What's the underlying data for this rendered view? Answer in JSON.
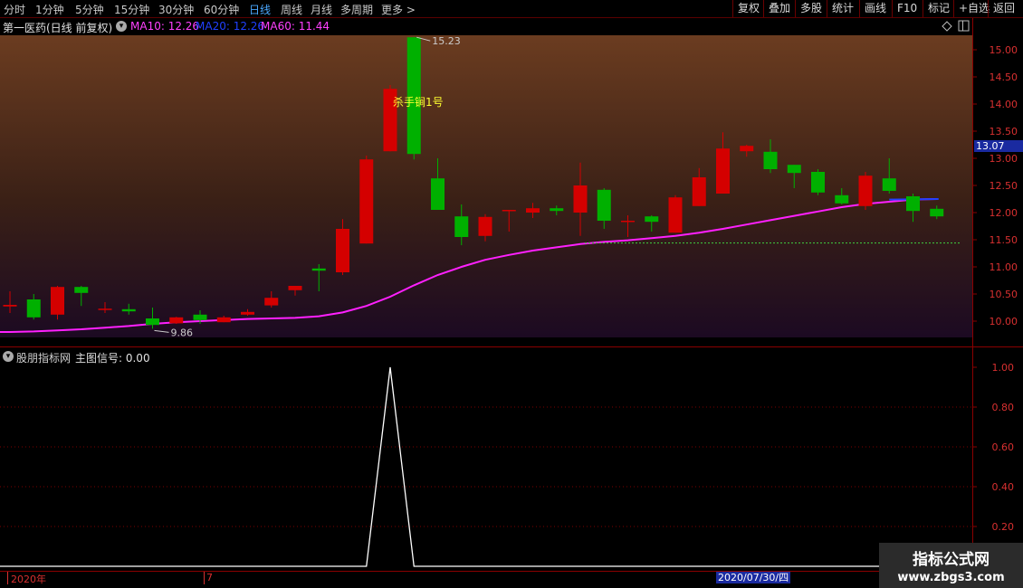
{
  "toolbar": {
    "periods": [
      {
        "label": "分时",
        "active": false
      },
      {
        "label": "1分钟",
        "active": false
      },
      {
        "label": "5分钟",
        "active": false
      },
      {
        "label": "15分钟",
        "active": false
      },
      {
        "label": "30分钟",
        "active": false
      },
      {
        "label": "60分钟",
        "active": false
      },
      {
        "label": "日线",
        "active": true
      },
      {
        "label": "周线",
        "active": false
      },
      {
        "label": "月线",
        "active": false
      },
      {
        "label": "多周期",
        "active": false
      },
      {
        "label": "更多 >",
        "active": false
      }
    ],
    "right_buttons": [
      "复权",
      "叠加",
      "多股",
      "统计",
      "画线",
      "F10",
      "标记",
      "+自选",
      "返回"
    ]
  },
  "title": {
    "stock": "第一医药(日线 前复权)",
    "ma10": "MA10: 12.26",
    "ma20": "MA20: 12.26",
    "ma60": "MA60: 11.44"
  },
  "chart_data": {
    "type": "candlestick",
    "ylim": [
      9.75,
      15.3
    ],
    "yticks": [
      "15.00",
      "14.50",
      "14.00",
      "13.50",
      "13.00",
      "12.50",
      "12.00",
      "11.50",
      "11.00",
      "10.50",
      "10.00"
    ],
    "current_price": "13.07",
    "candles": [
      {
        "o": 10.27,
        "h": 10.55,
        "l": 10.15,
        "c": 10.3
      },
      {
        "o": 10.4,
        "h": 10.5,
        "l": 10.03,
        "c": 10.07
      },
      {
        "o": 10.12,
        "h": 10.65,
        "l": 10.03,
        "c": 10.63
      },
      {
        "o": 10.63,
        "h": 10.65,
        "l": 10.28,
        "c": 10.52
      },
      {
        "o": 10.22,
        "h": 10.35,
        "l": 10.15,
        "c": 10.23
      },
      {
        "o": 10.22,
        "h": 10.32,
        "l": 10.12,
        "c": 10.18
      },
      {
        "o": 10.05,
        "h": 10.25,
        "l": 9.86,
        "c": 9.93
      },
      {
        "o": 9.96,
        "h": 10.08,
        "l": 9.95,
        "c": 10.07
      },
      {
        "o": 10.12,
        "h": 10.2,
        "l": 9.95,
        "c": 10.02
      },
      {
        "o": 9.98,
        "h": 10.1,
        "l": 9.98,
        "c": 10.07
      },
      {
        "o": 10.12,
        "h": 10.22,
        "l": 10.1,
        "c": 10.17
      },
      {
        "o": 10.29,
        "h": 10.55,
        "l": 10.25,
        "c": 10.43
      },
      {
        "o": 10.57,
        "h": 10.65,
        "l": 10.47,
        "c": 10.65
      },
      {
        "o": 10.97,
        "h": 11.05,
        "l": 10.55,
        "c": 10.93
      },
      {
        "o": 10.9,
        "h": 11.88,
        "l": 10.85,
        "c": 11.7
      },
      {
        "o": 11.43,
        "h": 13.05,
        "l": 11.43,
        "c": 12.98
      },
      {
        "o": 13.13,
        "h": 14.35,
        "l": 13.13,
        "c": 14.28
      },
      {
        "o": 15.23,
        "h": 15.23,
        "l": 12.98,
        "c": 13.08
      },
      {
        "o": 12.63,
        "h": 13.0,
        "l": 12.05,
        "c": 12.05
      },
      {
        "o": 11.93,
        "h": 12.15,
        "l": 11.4,
        "c": 11.55
      },
      {
        "o": 11.57,
        "h": 11.97,
        "l": 11.47,
        "c": 11.92
      },
      {
        "o": 12.03,
        "h": 12.05,
        "l": 11.65,
        "c": 12.05
      },
      {
        "o": 12.0,
        "h": 12.18,
        "l": 11.9,
        "c": 12.08
      },
      {
        "o": 12.08,
        "h": 12.13,
        "l": 11.95,
        "c": 12.03
      },
      {
        "o": 12.0,
        "h": 12.92,
        "l": 11.57,
        "c": 12.5
      },
      {
        "o": 12.42,
        "h": 12.45,
        "l": 11.7,
        "c": 11.85
      },
      {
        "o": 11.85,
        "h": 11.95,
        "l": 11.55,
        "c": 11.85
      },
      {
        "o": 11.93,
        "h": 11.95,
        "l": 11.65,
        "c": 11.83
      },
      {
        "o": 11.63,
        "h": 12.32,
        "l": 11.63,
        "c": 12.28
      },
      {
        "o": 12.12,
        "h": 12.82,
        "l": 12.12,
        "c": 12.65
      },
      {
        "o": 12.35,
        "h": 13.48,
        "l": 12.35,
        "c": 13.18
      },
      {
        "o": 13.13,
        "h": 13.25,
        "l": 13.03,
        "c": 13.23
      },
      {
        "o": 13.12,
        "h": 13.35,
        "l": 12.73,
        "c": 12.8
      },
      {
        "o": 12.88,
        "h": 12.88,
        "l": 12.45,
        "c": 12.73
      },
      {
        "o": 12.75,
        "h": 12.8,
        "l": 12.32,
        "c": 12.37
      },
      {
        "o": 12.32,
        "h": 12.45,
        "l": 12.15,
        "c": 12.17
      },
      {
        "o": 12.12,
        "h": 12.75,
        "l": 12.05,
        "c": 12.68
      },
      {
        "o": 12.63,
        "h": 13.0,
        "l": 12.35,
        "c": 12.4
      },
      {
        "o": 12.3,
        "h": 12.35,
        "l": 11.83,
        "c": 12.03
      },
      {
        "o": 12.07,
        "h": 12.13,
        "l": 11.88,
        "c": 11.93
      }
    ],
    "ma_line": [
      9.8,
      9.81,
      9.83,
      9.85,
      9.88,
      9.91,
      9.95,
      9.98,
      10.0,
      10.02,
      10.04,
      10.05,
      10.06,
      10.09,
      10.16,
      10.28,
      10.45,
      10.66,
      10.85,
      11.0,
      11.13,
      11.22,
      11.3,
      11.36,
      11.42,
      11.46,
      11.49,
      11.53,
      11.57,
      11.63,
      11.7,
      11.78,
      11.86,
      11.94,
      12.02,
      12.1,
      12.16,
      12.2,
      12.24,
      12.25
    ],
    "ma60_level": 11.44,
    "annotations": {
      "high_label": "15.23",
      "low_label": "9.86",
      "signal_text": "杀手锏1号"
    }
  },
  "indicator": {
    "name": "股朋指标网",
    "signal": "主图信号: 0.00",
    "yticks": [
      "1.00",
      "0.80",
      "0.60",
      "0.40",
      "0.20"
    ],
    "values": [
      0,
      0,
      0,
      0,
      0,
      0,
      0,
      0,
      0,
      0,
      0,
      0,
      0,
      0,
      0,
      0,
      1,
      0,
      0,
      0,
      0,
      0,
      0,
      0,
      0,
      0,
      0,
      0,
      0,
      0,
      0,
      0,
      0,
      0,
      0,
      0,
      0,
      0,
      0,
      0
    ]
  },
  "date_axis": {
    "year_label": "2020年",
    "month_label": "7",
    "cursor_date": "2020/07/30/四"
  },
  "watermark": {
    "line1": "指标公式网",
    "line2": "www.zbgs3.com"
  },
  "colors": {
    "up": "#d40000",
    "down": "#00b000",
    "ma": "#ff20ff",
    "accent": "#4aa8ff",
    "border": "#8a0000"
  }
}
